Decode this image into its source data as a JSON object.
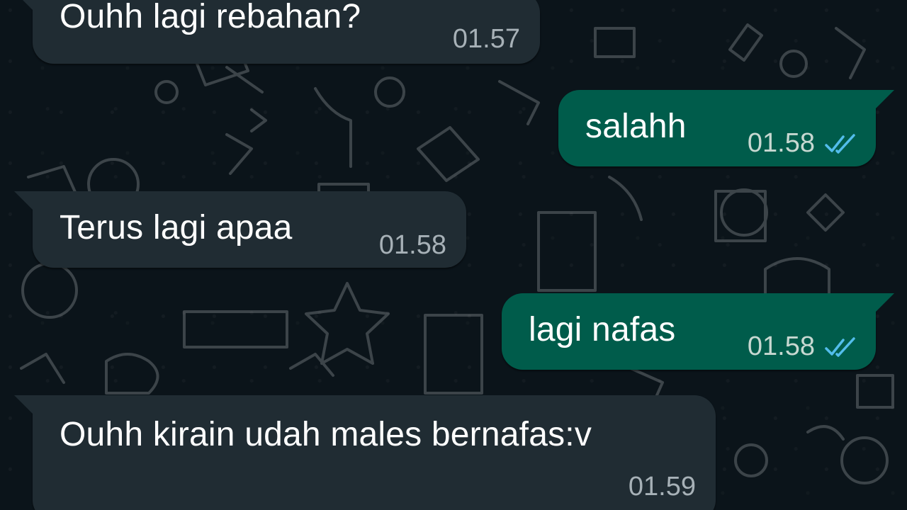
{
  "messages": [
    {
      "direction": "incoming",
      "text": "Ouhh lagi rebahan?",
      "time": "01.57"
    },
    {
      "direction": "outgoing",
      "text": "salahh",
      "time": "01.58",
      "status_icon": "double-check-icon",
      "status_color": "#53bdeb"
    },
    {
      "direction": "incoming",
      "text": "Terus lagi apaa",
      "time": "01.58"
    },
    {
      "direction": "outgoing",
      "text": "lagi nafas",
      "time": "01.58",
      "status_icon": "double-check-icon",
      "status_color": "#53bdeb"
    },
    {
      "direction": "incoming",
      "text": "Ouhh kirain udah males bernafas:v",
      "time": "01.59"
    }
  ],
  "colors": {
    "background": "#0b141a",
    "incoming_bubble": "#202c33",
    "outgoing_bubble": "#005c4b",
    "read_receipt": "#53bdeb"
  }
}
